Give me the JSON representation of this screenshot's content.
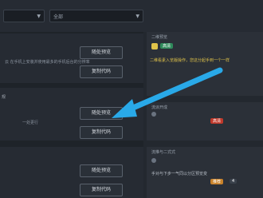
{
  "topbar": {
    "dropdown1": {
      "value": ""
    },
    "dropdown2": {
      "value": "全部"
    }
  },
  "rows": [
    {
      "desc": "云 在手机上安装并使用最多的手机后台的分辨率",
      "preview_label": "随处预览",
      "copy_label": "复制代码"
    },
    {
      "left_label": "规",
      "desc": "一处更行",
      "preview_label": "随处预览",
      "copy_label": "复制代码"
    },
    {
      "preview_label": "随处预览",
      "copy_label": "复制代码"
    }
  ],
  "right_panel": {
    "card1_title": "二维预览",
    "card1_badge": "高清",
    "card1_text": "二维看素入览版操作，您这分起手到一个一样",
    "card1_icon_color": "#e0c34a",
    "card2_title": "流派开成",
    "card2_tag": "高清",
    "card3_title": "流推与二式式",
    "card3_text": "手对与下步一气同以分区预览变",
    "card3_tag": "推荐",
    "card3_tag2": "4"
  },
  "accent_arrow_color": "#29a9e8"
}
